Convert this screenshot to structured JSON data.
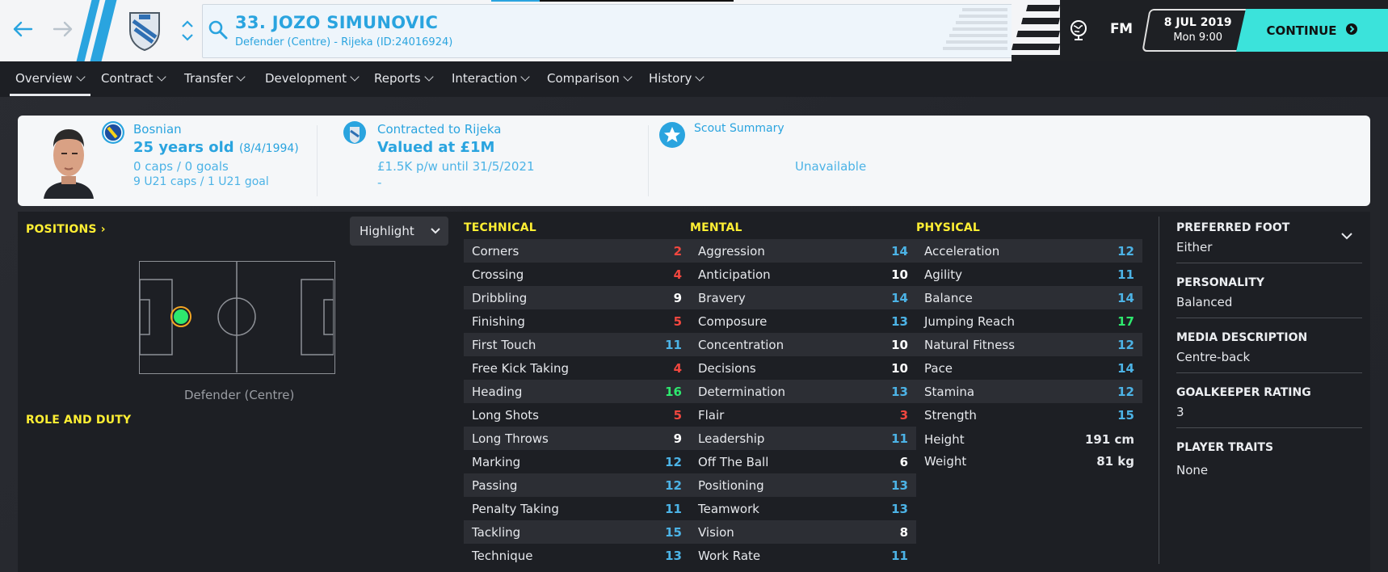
{
  "header": {
    "player_title": "33. JOZO SIMUNOVIC",
    "player_subtitle": "Defender (Centre) - Rijeka (ID:24016924)",
    "fm_logo": "FM",
    "date": "8 JUL 2019",
    "time": "Mon 9:00",
    "continue_label": "CONTINUE",
    "icons": [
      "back-arrow-icon",
      "forward-arrow-icon",
      "club-badge-icon",
      "chevron-up-icon",
      "chevron-down-icon",
      "search-icon",
      "globe-icon",
      "continue-arrow-icon"
    ],
    "colors": {
      "accent": "#2aa4df",
      "continue": "#3be3db"
    }
  },
  "tabs": [
    {
      "label": "Overview",
      "active": true
    },
    {
      "label": "Contract"
    },
    {
      "label": "Transfer"
    },
    {
      "label": "Development"
    },
    {
      "label": "Reports"
    },
    {
      "label": "Interaction"
    },
    {
      "label": "Comparison"
    },
    {
      "label": "History"
    }
  ],
  "summary": {
    "nationality": "Bosnian",
    "age": "25 years old",
    "dob": "(8/4/1994)",
    "caps": "0 caps / 0 goals",
    "u21_caps": "9 U21 caps / 1 U21 goal",
    "contract_label": "Contracted to Rijeka",
    "value": "Valued at £1M",
    "wage": "£1.5K p/w until 31/5/2021",
    "dash": "-",
    "scout_label": "Scout Summary",
    "scout_status": "Unavailable"
  },
  "positions": {
    "title": "POSITIONS",
    "highlight_label": "Highlight",
    "position_label": "Defender (Centre)",
    "role_title": "ROLE AND DUTY"
  },
  "technical": {
    "title": "TECHNICAL",
    "attrs": [
      {
        "name": "Corners",
        "value": 2
      },
      {
        "name": "Crossing",
        "value": 4
      },
      {
        "name": "Dribbling",
        "value": 9
      },
      {
        "name": "Finishing",
        "value": 5
      },
      {
        "name": "First Touch",
        "value": 11
      },
      {
        "name": "Free Kick Taking",
        "value": 4
      },
      {
        "name": "Heading",
        "value": 16
      },
      {
        "name": "Long Shots",
        "value": 5
      },
      {
        "name": "Long Throws",
        "value": 9
      },
      {
        "name": "Marking",
        "value": 12
      },
      {
        "name": "Passing",
        "value": 12
      },
      {
        "name": "Penalty Taking",
        "value": 11
      },
      {
        "name": "Tackling",
        "value": 15
      },
      {
        "name": "Technique",
        "value": 13
      }
    ]
  },
  "mental": {
    "title": "MENTAL",
    "attrs": [
      {
        "name": "Aggression",
        "value": 14
      },
      {
        "name": "Anticipation",
        "value": 10
      },
      {
        "name": "Bravery",
        "value": 14
      },
      {
        "name": "Composure",
        "value": 13
      },
      {
        "name": "Concentration",
        "value": 10
      },
      {
        "name": "Decisions",
        "value": 10
      },
      {
        "name": "Determination",
        "value": 13
      },
      {
        "name": "Flair",
        "value": 3
      },
      {
        "name": "Leadership",
        "value": 11
      },
      {
        "name": "Off The Ball",
        "value": 6
      },
      {
        "name": "Positioning",
        "value": 13
      },
      {
        "name": "Teamwork",
        "value": 13
      },
      {
        "name": "Vision",
        "value": 8
      },
      {
        "name": "Work Rate",
        "value": 11
      }
    ]
  },
  "physical": {
    "title": "PHYSICAL",
    "attrs": [
      {
        "name": "Acceleration",
        "value": 12
      },
      {
        "name": "Agility",
        "value": 11
      },
      {
        "name": "Balance",
        "value": 14
      },
      {
        "name": "Jumping Reach",
        "value": 17
      },
      {
        "name": "Natural Fitness",
        "value": 12
      },
      {
        "name": "Pace",
        "value": 14
      },
      {
        "name": "Stamina",
        "value": 12
      },
      {
        "name": "Strength",
        "value": 15
      }
    ],
    "height_label": "Height",
    "height_value": "191 cm",
    "weight_label": "Weight",
    "weight_value": "81 kg"
  },
  "info": {
    "preferred_foot_title": "PREFERRED FOOT",
    "preferred_foot": "Either",
    "personality_title": "PERSONALITY",
    "personality": "Balanced",
    "media_title": "MEDIA DESCRIPTION",
    "media": "Centre-back",
    "gk_title": "GOALKEEPER RATING",
    "gk": "3",
    "traits_title": "PLAYER TRAITS",
    "traits": "None"
  },
  "attr_colors": {
    "low": "#f2473f",
    "mid": "#ffffff",
    "good": "#4cb3e6",
    "high": "#2ee86e"
  }
}
